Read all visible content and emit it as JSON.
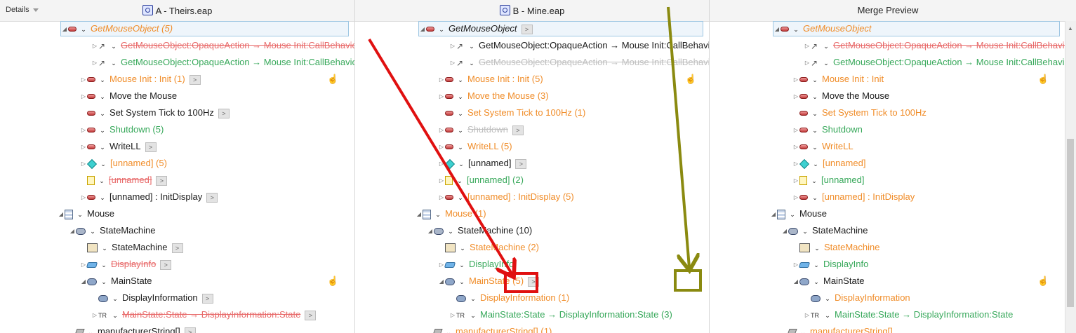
{
  "header": {
    "details_label": "Details",
    "columns": [
      {
        "title": "A - Theirs.eap"
      },
      {
        "title": "B - Mine.eap"
      },
      {
        "title": "Merge Preview"
      }
    ]
  },
  "panes": [
    {
      "rows": [
        {
          "text": "GetMouseObject (5)",
          "style": "orange italic",
          "icon": "action",
          "tri": "open",
          "sel": true,
          "level": 2
        },
        {
          "text": "GetMouseObject:OpaqueAction → Mouse Init:CallBehavio",
          "style": "strike",
          "icon": "flow",
          "tri": "closed",
          "level": 3
        },
        {
          "text": "GetMouseObject:OpaqueAction → Mouse Init:CallBehavio",
          "style": "green",
          "icon": "flow",
          "tri": "closed",
          "level": 3
        },
        {
          "text": "Mouse Init : Init (1)",
          "style": "orange",
          "icon": "action",
          "tri": "closed",
          "badge": true,
          "hand": true,
          "level": 2
        },
        {
          "text": "Move the Mouse",
          "style": "black",
          "icon": "action",
          "tri": "closed",
          "level": 2
        },
        {
          "text": "Set System Tick to 100Hz",
          "style": "black",
          "icon": "action",
          "tri": "none",
          "badge": true,
          "level": 2
        },
        {
          "text": "Shutdown (5)",
          "style": "green",
          "icon": "action",
          "tri": "closed",
          "level": 2
        },
        {
          "text": "WriteLL",
          "style": "black",
          "icon": "action",
          "tri": "closed",
          "badge": true,
          "level": 2
        },
        {
          "text": "[unnamed] (5)",
          "style": "orange",
          "icon": "diamond",
          "tri": "closed",
          "level": 2
        },
        {
          "text": "[unnamed]",
          "style": "strike",
          "icon": "note",
          "tri": "none",
          "badge": true,
          "level": 2
        },
        {
          "text": "[unnamed] : InitDisplay",
          "style": "black",
          "icon": "action",
          "tri": "closed",
          "badge": true,
          "level": 2
        },
        {
          "text": "Mouse",
          "style": "black",
          "icon": "class",
          "tri": "open",
          "level": 0
        },
        {
          "text": "StateMachine",
          "style": "black",
          "icon": "sm",
          "tri": "open",
          "level": 1
        },
        {
          "text": "StateMachine",
          "style": "black",
          "icon": "diag",
          "tri": "none",
          "badge": true,
          "level": 2
        },
        {
          "text": "DisplayInfo",
          "style": "strike",
          "icon": "display",
          "tri": "closed",
          "badge": true,
          "level": 2
        },
        {
          "text": "MainState",
          "style": "black",
          "icon": "state",
          "tri": "open",
          "hand": true,
          "level": 2
        },
        {
          "text": "DisplayInformation",
          "style": "black",
          "icon": "state",
          "tri": "none",
          "badge": true,
          "level": 3
        },
        {
          "text": "MainState:State → DisplayInformation:State",
          "style": "strike",
          "icon": "tr",
          "tri": "closed",
          "badge": true,
          "level": 3
        },
        {
          "text": "manufacturerString[]",
          "style": "black",
          "icon": "param",
          "tri": "none",
          "badge": true,
          "level": 1
        }
      ]
    },
    {
      "rows": [
        {
          "text": "GetMouseObject",
          "style": "black italic",
          "icon": "action",
          "tri": "open",
          "sel": true,
          "badge": true,
          "level": 2
        },
        {
          "text": "GetMouseObject:OpaqueAction → Mouse Init:CallBehavio",
          "style": "black",
          "icon": "flow",
          "tri": "closed",
          "level": 3
        },
        {
          "text": "GetMouseObject:OpaqueAction → Mouse Init:CallBehavio",
          "style": "struckgrey",
          "icon": "flow",
          "tri": "closed",
          "level": 3
        },
        {
          "text": "Mouse Init : Init (5)",
          "style": "orange",
          "icon": "action",
          "tri": "closed",
          "hand": true,
          "level": 2
        },
        {
          "text": "Move the Mouse (3)",
          "style": "orange",
          "icon": "action",
          "tri": "closed",
          "level": 2
        },
        {
          "text": "Set System Tick to 100Hz (1)",
          "style": "orange",
          "icon": "action",
          "tri": "none",
          "level": 2
        },
        {
          "text": "Shutdown",
          "style": "struckgrey",
          "icon": "action",
          "tri": "closed",
          "badge": true,
          "level": 2
        },
        {
          "text": "WriteLL (5)",
          "style": "orange",
          "icon": "action",
          "tri": "closed",
          "level": 2
        },
        {
          "text": "[unnamed]",
          "style": "black",
          "icon": "diamond",
          "tri": "closed",
          "badge": true,
          "level": 2
        },
        {
          "text": "[unnamed] (2)",
          "style": "green",
          "icon": "note",
          "tri": "closed",
          "level": 2
        },
        {
          "text": "[unnamed] : InitDisplay (5)",
          "style": "orange",
          "icon": "action",
          "tri": "closed",
          "level": 2
        },
        {
          "text": "Mouse (1)",
          "style": "orange",
          "icon": "class",
          "tri": "open",
          "level": 0
        },
        {
          "text": "StateMachine (10)",
          "style": "black",
          "icon": "sm",
          "tri": "open",
          "level": 1
        },
        {
          "text": "StateMachine (2)",
          "style": "orange",
          "icon": "diag",
          "tri": "none",
          "level": 2
        },
        {
          "text": "DisplayInfo",
          "style": "green",
          "icon": "display",
          "tri": "closed",
          "level": 2
        },
        {
          "text": "MainState (5)",
          "style": "orange",
          "icon": "state",
          "tri": "open",
          "badge": true,
          "level": 2
        },
        {
          "text": "DisplayInformation (1)",
          "style": "orange",
          "icon": "state",
          "tri": "none",
          "level": 3
        },
        {
          "text": "MainState:State → DisplayInformation:State (3)",
          "style": "green",
          "icon": "tr",
          "tri": "closed",
          "level": 3
        },
        {
          "text": "manufacturerString[] (1)",
          "style": "orange",
          "icon": "param",
          "tri": "none",
          "level": 1
        }
      ]
    },
    {
      "rows": [
        {
          "text": "GetMouseObject",
          "style": "orange italic",
          "icon": "action",
          "tri": "open",
          "sel": true,
          "level": 2
        },
        {
          "text": "GetMouseObject:OpaqueAction → Mouse Init:CallBehavio",
          "style": "strike",
          "icon": "flow",
          "tri": "closed",
          "level": 3
        },
        {
          "text": "GetMouseObject:OpaqueAction → Mouse Init:CallBehavio",
          "style": "green",
          "icon": "flow",
          "tri": "closed",
          "level": 3
        },
        {
          "text": "Mouse Init : Init",
          "style": "orange",
          "icon": "action",
          "tri": "closed",
          "hand": true,
          "level": 2
        },
        {
          "text": "Move the Mouse",
          "style": "black",
          "icon": "action",
          "tri": "closed",
          "level": 2
        },
        {
          "text": "Set System Tick to 100Hz",
          "style": "orange",
          "icon": "action",
          "tri": "none",
          "level": 2
        },
        {
          "text": "Shutdown",
          "style": "green",
          "icon": "action",
          "tri": "closed",
          "level": 2
        },
        {
          "text": "WriteLL",
          "style": "orange",
          "icon": "action",
          "tri": "closed",
          "level": 2
        },
        {
          "text": "[unnamed]",
          "style": "orange",
          "icon": "diamond",
          "tri": "closed",
          "level": 2
        },
        {
          "text": "[unnamed]",
          "style": "green",
          "icon": "note",
          "tri": "closed",
          "level": 2
        },
        {
          "text": "[unnamed] : InitDisplay",
          "style": "orange",
          "icon": "action",
          "tri": "closed",
          "level": 2
        },
        {
          "text": "Mouse",
          "style": "black",
          "icon": "class",
          "tri": "open",
          "level": 0
        },
        {
          "text": "StateMachine",
          "style": "black",
          "icon": "sm",
          "tri": "open",
          "level": 1
        },
        {
          "text": "StateMachine",
          "style": "orange",
          "icon": "diag",
          "tri": "none",
          "level": 2
        },
        {
          "text": "DisplayInfo",
          "style": "green",
          "icon": "display",
          "tri": "closed",
          "level": 2
        },
        {
          "text": "MainState",
          "style": "black",
          "icon": "state",
          "tri": "open",
          "hand": true,
          "level": 2
        },
        {
          "text": "DisplayInformation",
          "style": "orange",
          "icon": "state",
          "tri": "none",
          "level": 3
        },
        {
          "text": "MainState:State → DisplayInformation:State",
          "style": "green",
          "icon": "tr",
          "tri": "closed",
          "level": 3
        },
        {
          "text": "manufacturerString[]",
          "style": "orange",
          "icon": "param",
          "tri": "none",
          "level": 1
        }
      ]
    }
  ],
  "colors": {
    "orange": "#f08c28",
    "green": "#37a85a",
    "deleted": "#e86a6a",
    "annotation_red": "#e01010",
    "annotation_olive": "#8a8a10"
  }
}
